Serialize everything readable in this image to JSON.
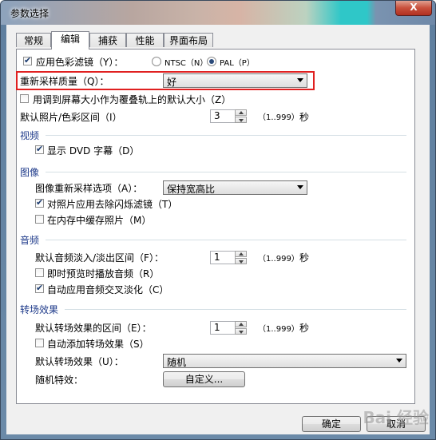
{
  "window": {
    "title": "参数选择",
    "close_label": "X"
  },
  "tabs": [
    {
      "label": "常规"
    },
    {
      "label": "编辑"
    },
    {
      "label": "捕获"
    },
    {
      "label": "性能"
    },
    {
      "label": "界面布局"
    }
  ],
  "active_tab": "编辑",
  "edit": {
    "color_filter": {
      "label": "应用色彩滤镜（Y）：",
      "checked": true
    },
    "ntsc": {
      "label": "NTSC（N）",
      "selected": false
    },
    "pal": {
      "label": "PAL（P）",
      "selected": true
    },
    "resample_quality": {
      "label": "重新采样质量（Q）：",
      "value": "好"
    },
    "fit_overlay": {
      "label": "用调到屏幕大小作为覆叠轨上的默认大小（Z）",
      "checked": false
    },
    "default_photo_duration": {
      "label": "默认照片/色彩区间（I）",
      "value": "3",
      "range": "（1..999）",
      "unit": "秒"
    }
  },
  "video": {
    "header": "视频",
    "show_dvd_subtitle": {
      "label": "显示 DVD 字幕（D）",
      "checked": true
    }
  },
  "image": {
    "header": "图像",
    "resample_option": {
      "label": "图像重新采样选项（A）：",
      "value": "保持宽高比"
    },
    "deflicker": {
      "label": "对照片应用去除闪烁滤镜（T）",
      "checked": true
    },
    "cache_in_memory": {
      "label": "在内存中缓存照片（M）",
      "checked": false
    }
  },
  "audio": {
    "header": "音频",
    "fade_duration": {
      "label": "默认音频淡入/淡出区间（F）：",
      "value": "1",
      "range": "（1..999）",
      "unit": "秒"
    },
    "preview_audio": {
      "label": "即时预览时播放音频（R）",
      "checked": false
    },
    "auto_crossfade": {
      "label": "自动应用音频交叉淡化（C）",
      "checked": true
    }
  },
  "transition": {
    "header": "转场效果",
    "duration": {
      "label": "默认转场效果的区间（E）：",
      "value": "1",
      "range": "（1..999）",
      "unit": "秒"
    },
    "auto_add": {
      "label": "自动添加转场效果（S）",
      "checked": false
    },
    "default_effect": {
      "label": "默认转场效果（U）：",
      "value": "随机"
    },
    "random_effects": {
      "label": "随机特效：",
      "button": "自定义..."
    }
  },
  "footer": {
    "ok": "确定",
    "cancel": "取消"
  },
  "watermark": "Bai 经验"
}
